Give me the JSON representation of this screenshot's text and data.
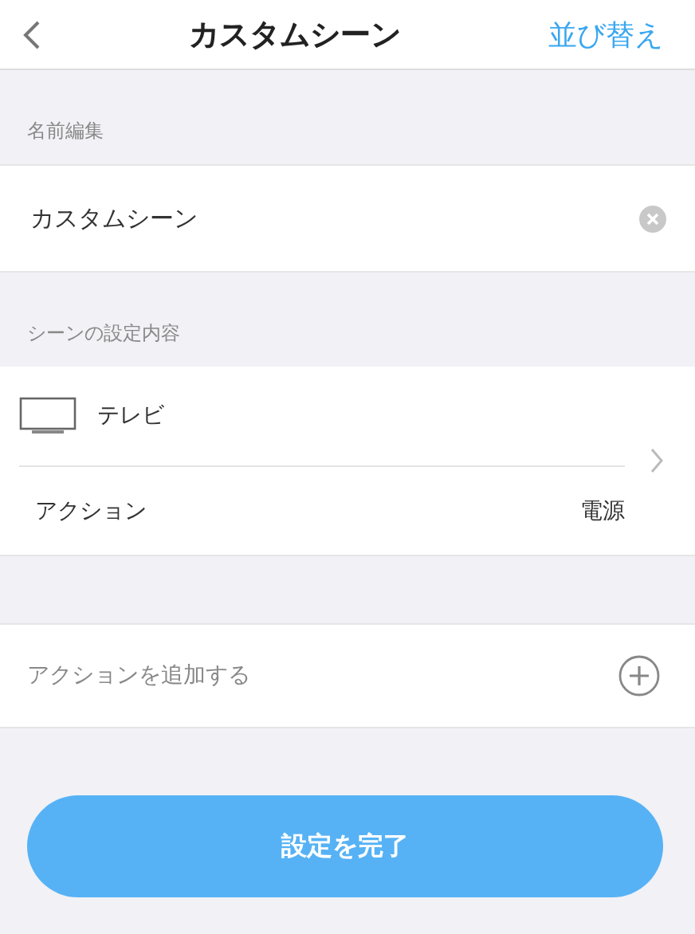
{
  "header": {
    "title": "カスタムシーン",
    "action": "並び替え"
  },
  "name_section": {
    "label": "名前編集",
    "value": "カスタムシーン"
  },
  "scene_section": {
    "label": "シーンの設定内容"
  },
  "device": {
    "name": "テレビ",
    "action_label": "アクション",
    "action_value": "電源"
  },
  "add_action": {
    "label": "アクションを追加する"
  },
  "submit_button": "設定を完了"
}
